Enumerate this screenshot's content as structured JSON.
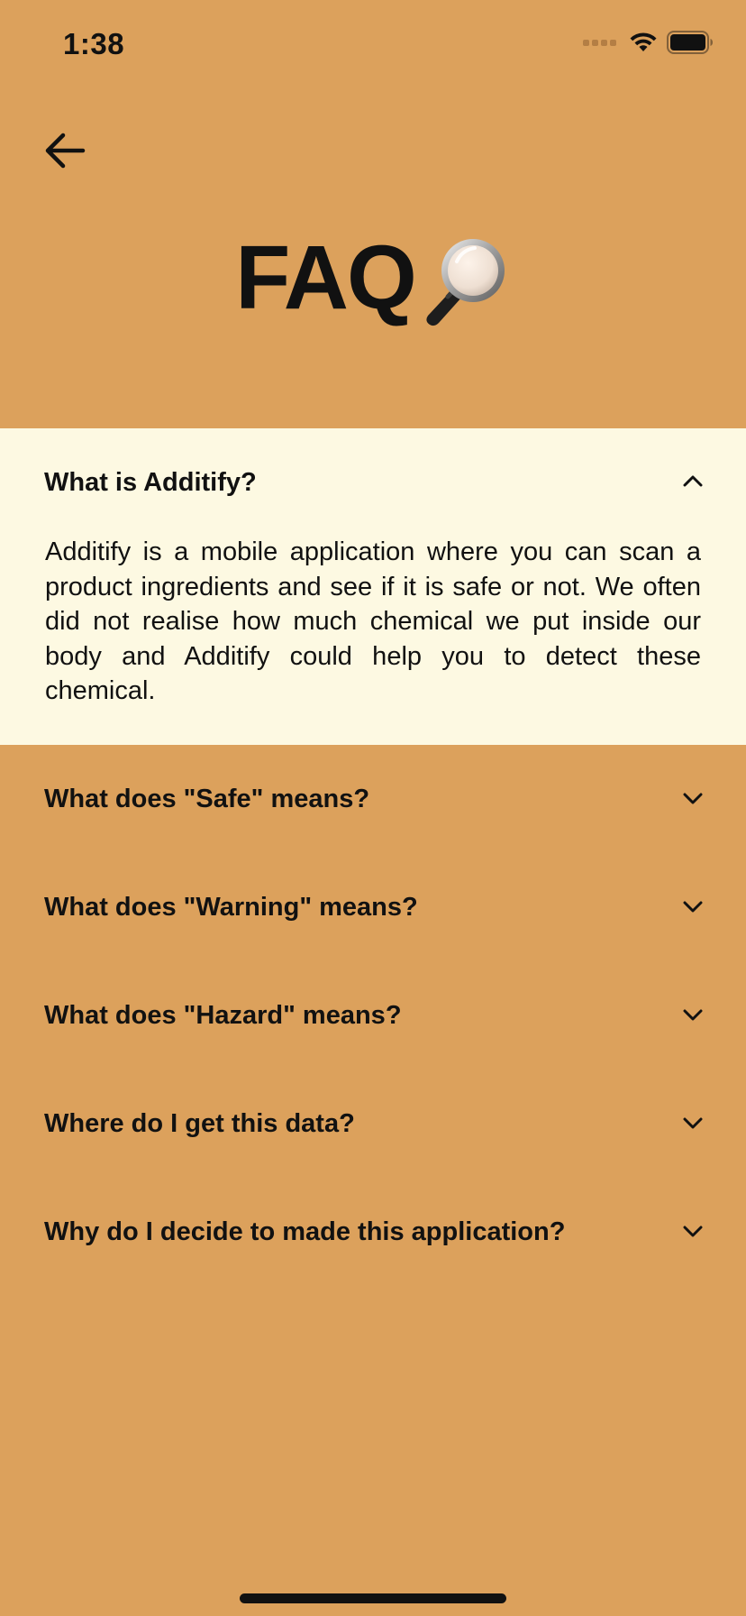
{
  "status_bar": {
    "time": "1:38"
  },
  "header": {
    "title": "FAQ",
    "title_icon": "magnifying-glass-icon",
    "back_icon": "arrow-left-icon"
  },
  "faq": {
    "items": [
      {
        "question": "What is Additify?",
        "expanded": true,
        "answer": "Additify is a mobile application where you can scan a product ingredients and see if it is safe or not. We often did not realise how much chemical we put inside our body and Additify could help you to detect these chemical."
      },
      {
        "question": "What does \"Safe\" means?",
        "expanded": false
      },
      {
        "question": "What does \"Warning\" means?",
        "expanded": false
      },
      {
        "question": "What does \"Hazard\" means?",
        "expanded": false
      },
      {
        "question": "Where do I get this data?",
        "expanded": false
      },
      {
        "question": "Why do I decide to made this application?",
        "expanded": false
      }
    ]
  },
  "colors": {
    "background": "#DCA15C",
    "expanded_background": "#FDF9E2",
    "text": "#111111"
  }
}
